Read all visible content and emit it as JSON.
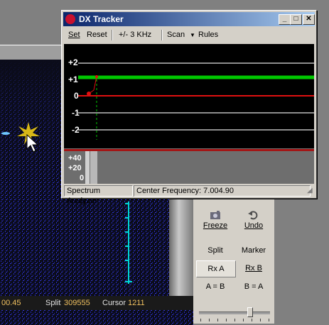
{
  "background_app": {
    "status": {
      "freq_partial": "00.45",
      "split_label": "Split",
      "split_value": "309555",
      "cursor_label": "Cursor",
      "cursor_value": "1211"
    },
    "controls": {
      "freeze": "Freeze",
      "undo": "Undo",
      "split": "Split",
      "marker": "Marker",
      "rx_a": "Rx A",
      "rx_b": "Rx B",
      "a_eq_b": "A = B",
      "b_eq_a": "B = A"
    }
  },
  "dx_tracker": {
    "title": "DX Tracker",
    "menu": {
      "set": "Set",
      "reset": "Reset",
      "range": "+/- 3 KHz",
      "scan": "Scan",
      "rules": "Rules"
    },
    "plot_y_labels": [
      "+2",
      "+1",
      "0",
      "-1",
      "-2"
    ],
    "spectrum_labels": [
      "+40",
      "+20",
      "0"
    ],
    "status_left": "Spectrum Analyzer",
    "status_center": "Center Frequency: 7.004.90",
    "colors": {
      "signal_line": "#00c800",
      "zero_line": "#e01010",
      "grid_line": "#c0c0c0",
      "marker": "#e01010"
    }
  }
}
